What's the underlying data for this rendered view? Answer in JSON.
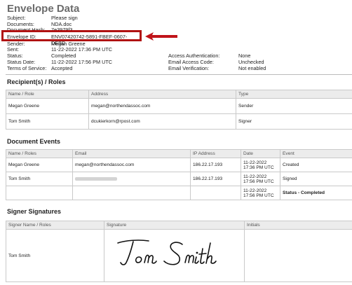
{
  "title": "Envelope Data",
  "envelope": {
    "subject_label": "Subject:",
    "subject_value": "Please sign",
    "documents_label": "Documents:",
    "documents_value": "NDA.doc",
    "document_hash_label": "Document Hash:",
    "document_hash_value": "7e3979f3",
    "envelope_id_label": "Envelope ID:",
    "envelope_id_value": "ENV07420742-5891-FBEF-0607-DEBD",
    "sender_label": "Sender:",
    "sender_value": "Megan Greene",
    "sent_label": "Sent:",
    "sent_value": "11-22-2022 17:36 PM UTC",
    "status_label": "Status:",
    "status_value": "Completed",
    "status_date_label": "Status Date:",
    "status_date_value": "11-22-2022 17:56 PM UTC",
    "terms_label": "Terms of Service:",
    "terms_value": "Accepted",
    "access_auth_label": "Access Authentication:",
    "access_auth_value": "None",
    "email_access_label": "Email Access Code:",
    "email_access_value": "Unchecked",
    "email_verif_label": "Email Verification:",
    "email_verif_value": "Not enabled"
  },
  "recipients": {
    "heading": "Recipient(s) / Roles",
    "columns": [
      "Name / Role",
      "Address",
      "Type"
    ],
    "rows": [
      [
        "Megan Greene",
        "megan@northendassoc.com",
        "Sender"
      ],
      [
        "Tom Smith",
        "dcukierkorn@rpost.com",
        "Signer"
      ]
    ]
  },
  "events": {
    "heading": "Document Events",
    "columns": [
      "Name / Roles",
      "Email",
      "IP Address",
      "Date",
      "Event"
    ],
    "rows": [
      [
        "Megan Greene",
        "megan@northendassoc.com",
        "186.22.17.193",
        "11-22-2022 17:36 PM UTC",
        "Created"
      ],
      [
        "Tom Smith",
        "",
        "186.22.17.193",
        "11-22-2022 17:56 PM UTC",
        "Signed"
      ],
      [
        "",
        "",
        "",
        "11-22-2022 17:56 PM UTC",
        "Status - Completed"
      ]
    ]
  },
  "signatures": {
    "heading": "Signer Signatures",
    "columns": [
      "Signer Name / Roles",
      "Signature",
      "Initials"
    ],
    "rows": [
      [
        "Tom Smith",
        "Tom Smith",
        ""
      ]
    ]
  },
  "colors": {
    "highlight_border": "#b01212",
    "header_bg": "#ececec",
    "title": "#6b6b6b"
  }
}
